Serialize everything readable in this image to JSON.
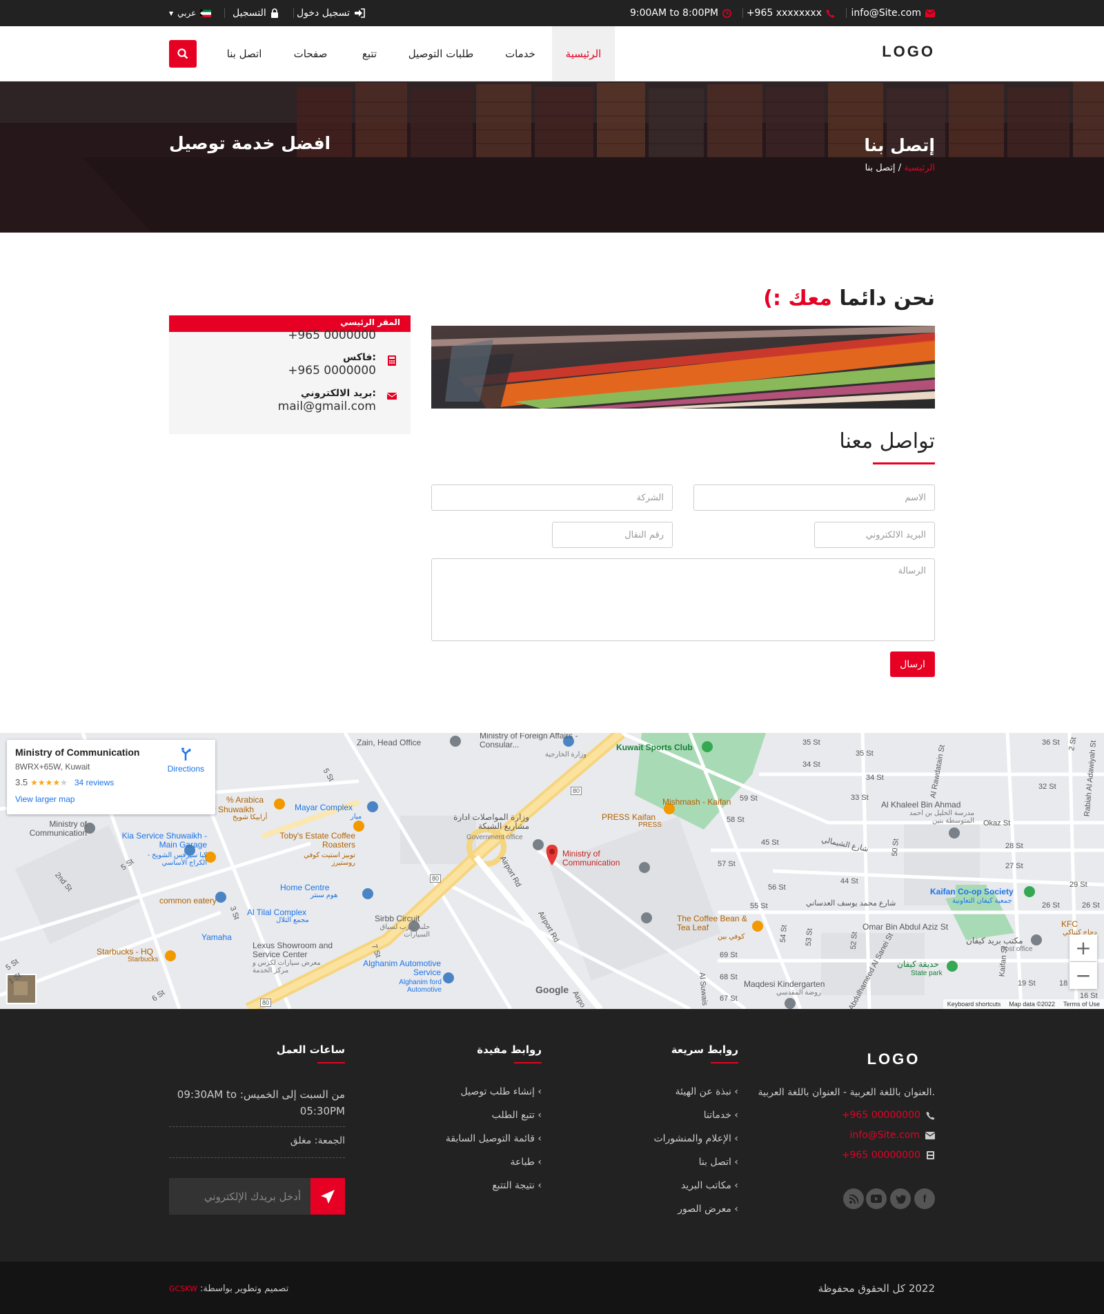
{
  "topbar": {
    "email": "info@Site.com",
    "phone": "+965 xxxxxxxx",
    "hours": "9:00AM to 8:00PM",
    "login": "تسجيل دخول",
    "register": "التسجيل",
    "language": "عربي"
  },
  "header": {
    "logo": "LOGO",
    "nav": [
      "الرئيسية",
      "خدمات",
      "طلبات التوصيل",
      "تتبع",
      "صفحات",
      "اتصل بنا"
    ],
    "active_nav": "الرئيسية"
  },
  "banner": {
    "title": "إتصل بنا",
    "breadcrumb_home": "الرئيسية",
    "breadcrumb_sep": "/",
    "breadcrumb_current": "إتصل بنا",
    "slogan": "افضل خدمة توصيل"
  },
  "main": {
    "heading_prefix": "نحن دائما",
    "heading_highlight": "معك :)",
    "form_title": "تواصل معنا",
    "form": {
      "name_placeholder": "الاسم",
      "company_placeholder": "الشركة",
      "email_placeholder": "البريد الالكتروني",
      "mobile_placeholder": "رقم النقال",
      "message_placeholder": "الرسالة",
      "send_label": "ارسال"
    },
    "contact_box": {
      "header": "المقر الرئيسي",
      "phone": "+965 0000000",
      "fax_label": "فاكس:",
      "fax": "+965 0000000",
      "email_label": "بريد الالكتروني:",
      "email": "mail@gmail.com"
    }
  },
  "map": {
    "place_name": "Ministry of Communication",
    "plus_code": "8WRX+65W, Kuwait",
    "rating": "3.5",
    "reviews": "34 reviews",
    "directions": "Directions",
    "larger_map": "View larger map",
    "labels": {
      "zain": "Zain, Head Office",
      "mfa": "Ministry of Foreign Affairs - Consular...",
      "mfa_ar": "وزارة الخارجية",
      "kuwait_sports": "Kuwait Sports Club",
      "arabica": "% Arabica",
      "shuwaikh": "ery Shuwaikh",
      "arabica_ar": "أرابيكا شويخ",
      "mayar": "Mayar Complex",
      "mayar_ar": "ميار",
      "moc_ar": "وزارة المواصلات ادارة مشاريع الشبكة",
      "gov_office": "Government office",
      "mishmash": "Mishmash - Kaifan",
      "press": "PRESS Kaifan",
      "press_sub": "PRESS",
      "ministry_left": "Ministry of Communication",
      "kia": "Kia Service Shuwaikh - Main Garage",
      "kia_ar": "كيا سيرفس الشويخ - الكراج الأساسي",
      "tobys": "Toby's Estate Coffee Roasters",
      "tobys_ar": "توبيز استيت كوفي روستيرز",
      "ministry_pin": "Ministry of Communication",
      "khaleel": "Al Khaleel Bin Ahmad",
      "khaleel_ar": "مدرسة الخليل بن احمد المتوسطة بنين",
      "okaz": "Okaz St",
      "home_centre": "Home Centre",
      "home_centre_ar": "هوم سنتر",
      "common": "common eatery",
      "tilal": "Al Tilal Complex",
      "tilal_ar": "مجمع التلال",
      "sirbb": "Sirbb Circuit",
      "sirbb_ar": "حلبة سرب لسباق السيارات",
      "yamaha": "Yamaha",
      "starbucks": "Starbucks - HQ",
      "starbucks_sub": "Starbucks",
      "lexus": "Lexus Showroom and Service Center",
      "lexus_ar": "معرض سيارات لكزس و مركز الخدمة",
      "alghanim": "Alghanim Automotive Service",
      "alghanim_sub": "Alghanim ford Automotive",
      "coffee_bean": "The Coffee Bean & Tea Leaf",
      "coffee_bean_ar": "كوفي بين",
      "omar": "Omar Bin Abdul Aziz St",
      "kaifan_coop": "Kaifan Co-op Society",
      "kaifan_coop_ar": "جمعية كيفان التعاونية",
      "kfc": "KFC",
      "kfc_ar": "دجاج كنتاكي",
      "post": "مكتب بريد كيفان",
      "post_sub": "Post office",
      "kaifan_park_ar": "حديقة كيفان",
      "kaifan_park": "State park",
      "maqdesi": "Maqdesi Kindergarten",
      "maqdesi_ar": "روضة المقدسي",
      "airport1": "Airport Rd",
      "airport2": "Airport Rd",
      "sanei": "Abdulhameed Al Sanei St",
      "rawda": "Al Rawdatain St",
      "adawiyah": "Rabiah Al Adawiyah St",
      "yousef": "شارع محمد يوسف العدساني",
      "shimali": "شارع الشيمالي",
      "streets": [
        "35 St",
        "36 St",
        "34 St",
        "35 St",
        "34 St",
        "33 St",
        "32 St",
        "59 St",
        "58 St",
        "45 St",
        "57 St",
        "56 St",
        "44 St",
        "55 St",
        "69 St",
        "68 St",
        "67 St",
        "28 St",
        "27 St",
        "29 St",
        "26 St",
        "26 St",
        "18 St",
        "19 St",
        "16 St",
        "2 St",
        "5 St",
        "5 St",
        "2nd St",
        "3 St",
        "7 St",
        "6 St",
        "5 St",
        "1 St",
        "50 St",
        "52 St",
        "Kaifan St",
        "54 St",
        "53 St",
        "Al Suwais",
        "Airpo"
      ],
      "route80": "80"
    },
    "google": "Google",
    "footer_links": [
      "Keyboard shortcuts",
      "Map data ©2022",
      "Terms of Use"
    ]
  },
  "footer": {
    "logo": "LOGO",
    "address": "العنوان باللغة العربية - العنوان باللغة العربية.",
    "phone": "+965 00000000",
    "email": "info@Site.com",
    "fax": "+965 00000000",
    "quick_links_title": "روابط سريعة",
    "quick_links": [
      "نبذة عن الهيئة",
      "خدماتنا",
      "الإعلام والمنشورات",
      "اتصل بنا",
      "مكاتب البريد",
      "معرض الصور"
    ],
    "useful_links_title": "روابط مفيدة",
    "useful_links": [
      "إنشاء طلب توصيل",
      "تتبع الطلب",
      "قائمة التوصيل السابقة",
      "طباعة",
      "نتيجة التتبع"
    ],
    "hours_title": "ساعات العمل",
    "hours_weekdays": "من السبت إلى الخميس: 09:30AM to 05:30PM",
    "hours_friday": "الجمعة: مغلق",
    "newsletter_placeholder": "أدخل بريدك الإلكتروني"
  },
  "copyright": {
    "year": "2022",
    "text": "كل الحقوق محفوظة",
    "credit": "تصميم وتطوير بواسطة:",
    "company": "GCSKW"
  },
  "colors": {
    "accent": "#e60023",
    "dark": "#222222",
    "footer_bottom": "#141414"
  }
}
